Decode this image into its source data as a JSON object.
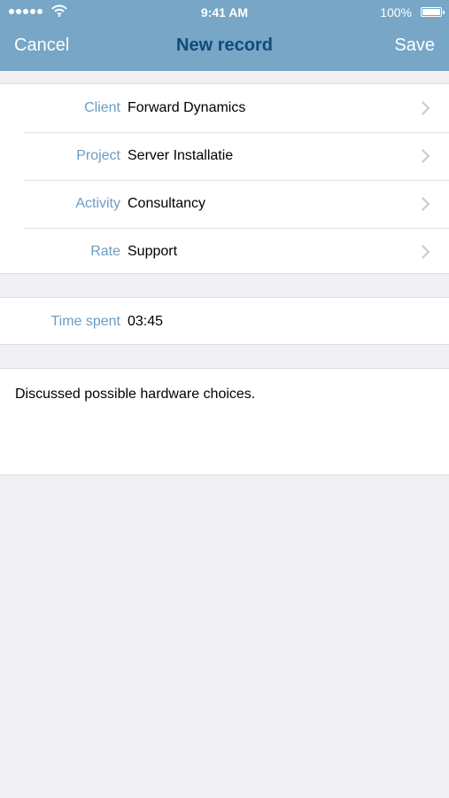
{
  "status_bar": {
    "time": "9:41 AM",
    "battery": "100%"
  },
  "nav": {
    "cancel_label": "Cancel",
    "title": "New record",
    "save_label": "Save"
  },
  "fields": [
    {
      "label": "Client",
      "value": "Forward Dynamics"
    },
    {
      "label": "Project",
      "value": "Server Installatie"
    },
    {
      "label": "Activity",
      "value": "Consultancy"
    },
    {
      "label": "Rate",
      "value": "Support"
    }
  ],
  "time_spent": {
    "label": "Time spent",
    "value": "03:45"
  },
  "notes": {
    "text": "Discussed possible hardware choices."
  },
  "colors": {
    "nav_bar": "#77a6c6",
    "title": "#104b7a",
    "label": "#6b9cc2",
    "background": "#efeff4"
  }
}
